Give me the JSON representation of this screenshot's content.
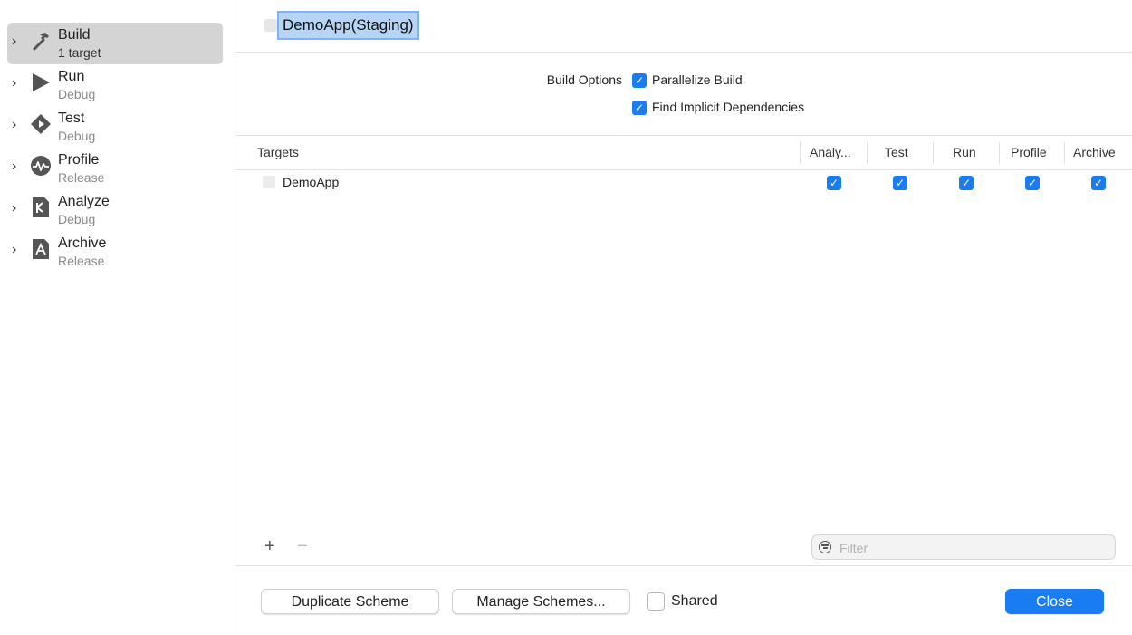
{
  "sidebar": {
    "items": [
      {
        "title": "Build",
        "subtitle": "1 target",
        "icon": "hammer-icon",
        "selected": true
      },
      {
        "title": "Run",
        "subtitle": "Debug",
        "icon": "play-icon",
        "selected": false
      },
      {
        "title": "Test",
        "subtitle": "Debug",
        "icon": "test-diamond-icon",
        "selected": false
      },
      {
        "title": "Profile",
        "subtitle": "Release",
        "icon": "profile-waveform-icon",
        "selected": false
      },
      {
        "title": "Analyze",
        "subtitle": "Debug",
        "icon": "analyze-icon",
        "selected": false
      },
      {
        "title": "Archive",
        "subtitle": "Release",
        "icon": "archive-icon",
        "selected": false
      }
    ]
  },
  "scheme": {
    "name": "DemoApp(Staging)"
  },
  "build_options": {
    "label": "Build Options",
    "parallelize": {
      "label": "Parallelize Build",
      "checked": true
    },
    "implicit_deps": {
      "label": "Find Implicit Dependencies",
      "checked": true
    }
  },
  "targets_table": {
    "headers": {
      "targets": "Targets",
      "analyze": "Analy...",
      "test": "Test",
      "run": "Run",
      "profile": "Profile",
      "archive": "Archive"
    },
    "rows": [
      {
        "name": "DemoApp",
        "analyze": true,
        "test": true,
        "run": true,
        "profile": true,
        "archive": true
      }
    ]
  },
  "filter": {
    "placeholder": "Filter",
    "value": ""
  },
  "footer": {
    "duplicate_label": "Duplicate Scheme",
    "manage_label": "Manage Schemes...",
    "shared_label": "Shared",
    "shared_checked": false,
    "close_label": "Close"
  },
  "colors": {
    "accent": "#1a7cf2",
    "selection": "#d4d4d4"
  }
}
